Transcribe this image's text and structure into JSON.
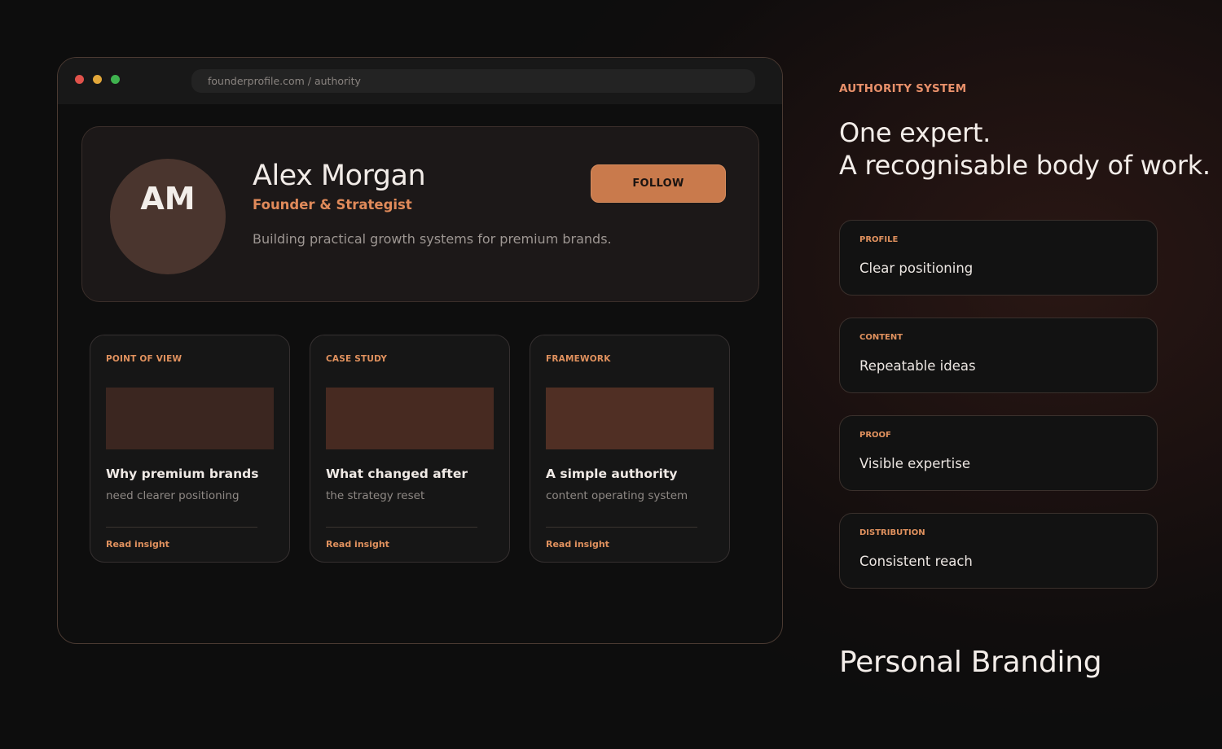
{
  "browser": {
    "url": "founderprofile.com / authority"
  },
  "profile": {
    "initials": "AM",
    "name": "Alex Morgan",
    "role": "Founder & Strategist",
    "bio": "Building practical growth systems for premium brands.",
    "follow_label": "FOLLOW"
  },
  "cards": [
    {
      "tag": "POINT OF VIEW",
      "title": "Why premium brands",
      "subtitle": "need clearer positioning",
      "link": "Read insight"
    },
    {
      "tag": "CASE STUDY",
      "title": "What changed after",
      "subtitle": "the strategy reset",
      "link": "Read insight"
    },
    {
      "tag": "FRAMEWORK",
      "title": "A simple authority",
      "subtitle": "content operating system",
      "link": "Read insight"
    }
  ],
  "panel": {
    "eyebrow": "AUTHORITY SYSTEM",
    "headline_line1": "One expert.",
    "headline_line2": "A recognisable body of work.",
    "features": [
      {
        "label": "PROFILE",
        "value": "Clear positioning"
      },
      {
        "label": "CONTENT",
        "value": "Repeatable ideas"
      },
      {
        "label": "PROOF",
        "value": "Visible expertise"
      },
      {
        "label": "DISTRIBUTION",
        "value": "Consistent reach"
      }
    ],
    "footer_title": "Personal Branding"
  },
  "colors": {
    "accent": "#e0915e",
    "button": "#c97a4c",
    "background": "#0e0e0e"
  }
}
